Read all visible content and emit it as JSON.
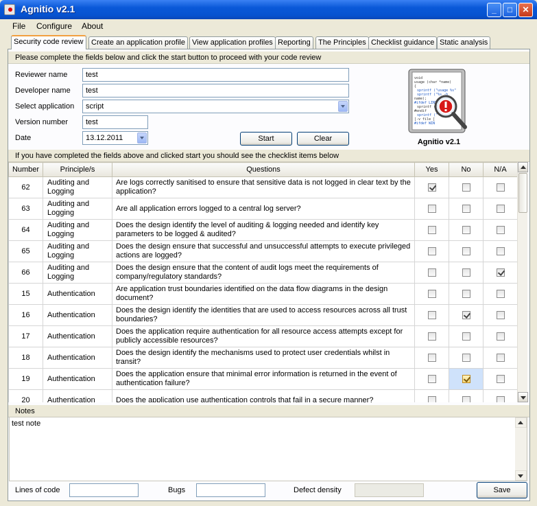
{
  "window": {
    "title": "Agnitio v2.1",
    "min": "_",
    "max": "□",
    "close": "✕"
  },
  "menu": {
    "items": [
      "File",
      "Configure",
      "About"
    ]
  },
  "tabs": [
    "Security code review",
    "Create an application profile",
    "View application profiles",
    "Reporting",
    "The Principles",
    "Checklist guidance",
    "Static analysis"
  ],
  "form": {
    "instructions": "Please complete the fields below and click the start button to proceed with your code review",
    "reviewer_label": "Reviewer name",
    "reviewer_value": "test",
    "developer_label": "Developer name",
    "developer_value": "test",
    "application_label": "Select application",
    "application_value": "script",
    "version_label": "Version number",
    "version_value": "test",
    "date_label": "Date",
    "date_value": "13.12.2011",
    "start_label": "Start",
    "clear_label": "Clear",
    "logo_caption": "Agnitio v2.1"
  },
  "checklist": {
    "instructions": "If you have completed the fields above and clicked start you should see the checklist items below",
    "headers": [
      "Number",
      "Principle/s",
      "Questions",
      "Yes",
      "No",
      "N/A"
    ],
    "rows": [
      {
        "number": "62",
        "principle": "Auditing and Logging",
        "question": "Are logs correctly sanitised to ensure that sensitive data is not logged in clear text by the application?",
        "yes": true,
        "no": false,
        "na": false
      },
      {
        "number": "63",
        "principle": "Auditing and Logging",
        "question": "Are all application errors logged to a central log server?",
        "yes": false,
        "no": false,
        "na": false
      },
      {
        "number": "64",
        "principle": "Auditing and Logging",
        "question": "Does the design identify the level of auditing & logging needed and identify key parameters to be logged & audited?",
        "yes": false,
        "no": false,
        "na": false
      },
      {
        "number": "65",
        "principle": "Auditing and Logging",
        "question": "Does the design ensure that successful and unsuccessful attempts to execute privileged actions are logged?",
        "yes": false,
        "no": false,
        "na": false
      },
      {
        "number": "66",
        "principle": "Auditing and Logging",
        "question": "Does the design ensure that the content of audit logs meet the requirements of company/regulatory standards?",
        "yes": false,
        "no": false,
        "na": true
      },
      {
        "number": "15",
        "principle": "Authentication",
        "question": "Are application trust boundaries identified on the data flow diagrams in the design document?",
        "yes": false,
        "no": false,
        "na": false
      },
      {
        "number": "16",
        "principle": "Authentication",
        "question": "Does the design identify the identities that are used to access resources across all trust boundaries?",
        "yes": false,
        "no": true,
        "na": false
      },
      {
        "number": "17",
        "principle": "Authentication",
        "question": "Does the application require authentication for all resource access attempts except for publicly accessible resources?",
        "yes": false,
        "no": false,
        "na": false
      },
      {
        "number": "18",
        "principle": "Authentication",
        "question": "Does the design identify the mechanisms used to protect user credentials whilst in transit?",
        "yes": false,
        "no": false,
        "na": false
      },
      {
        "number": "19",
        "principle": "Authentication",
        "question": "Does the application ensure that minimal error information is returned in the event of authentication failure?",
        "yes": false,
        "no": true,
        "na": false,
        "selected": "no"
      },
      {
        "number": "20",
        "principle": "Authentication",
        "question": "Does the application use authentication controls that fail in a secure manner?",
        "yes": false,
        "no": false,
        "na": false
      }
    ]
  },
  "notes": {
    "label": "Notes",
    "text": "test note"
  },
  "footer": {
    "loc_label": "Lines of code",
    "loc_value": "",
    "bugs_label": "Bugs",
    "bugs_value": "",
    "density_label": "Defect density",
    "density_value": "",
    "save_label": "Save"
  }
}
